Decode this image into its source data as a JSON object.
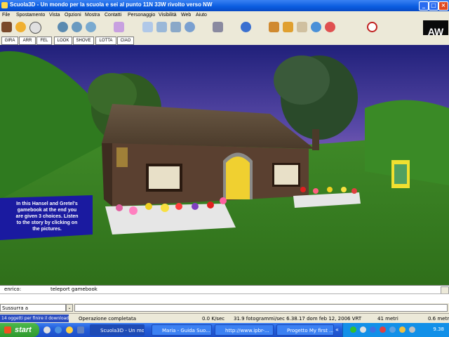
{
  "window": {
    "title": "Scuola3D - Un mondo per la scuola e sei al punto 11N 33W rivolto verso NW",
    "minimize": "_",
    "maximize": "□",
    "close": "×"
  },
  "menu": [
    "File",
    "Spostamento",
    "Vista",
    "Opzioni",
    "Mostra",
    "Contatti",
    "Personaggio",
    "Visibilità",
    "Web",
    "Aiuto"
  ],
  "commands": [
    "GIRA",
    "ARR",
    "FEL",
    "LOOK",
    "SHOVE",
    "LOTTA",
    "CIAO"
  ],
  "logo": "AW",
  "sign": {
    "lines": [
      "In this Hansel and Gretel's",
      "gamebook at the end you",
      "are given 3 choices. Listen",
      "to the story by clicking on",
      "the pictures."
    ]
  },
  "chat": {
    "user": "enrico:",
    "message": "teleport gamebook",
    "input_placeholder": "Sussurra a",
    "dropdown": "⌄"
  },
  "status": {
    "downloads": "14 oggetti per finire il download",
    "operation": "Operazione completata",
    "speed": "0.0 K/sec",
    "frames": "31.9 fotogrammi/sec 6.38.17 dom feb 12, 2006 VRT",
    "distance": "41 metri",
    "height": "0.6 metri"
  },
  "taskbar": {
    "start": "start",
    "items": [
      "Scuola3D - Un mo...",
      "Maria - Guida Suo...",
      "http://www.ipbr-...",
      "Progetto My first ..."
    ],
    "clock": "9.38"
  },
  "colors": {
    "titlebar": "#0a5ce0",
    "taskbar": "#245edb",
    "start": "#3a9e3a",
    "sign": "#1a1aa0"
  }
}
